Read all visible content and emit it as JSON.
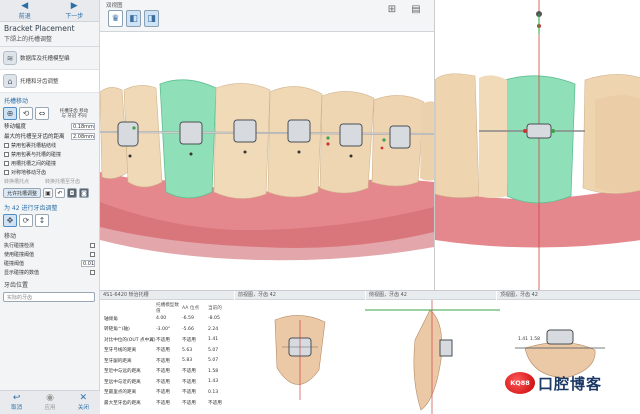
{
  "nav": {
    "prev": "前退",
    "next": "下一步"
  },
  "panel": {
    "title": "Bracket Placement",
    "subtitle": "下颌上的托槽调整",
    "steps": [
      {
        "label": "数据库及托槽模型编"
      },
      {
        "label": "托槽和牙齿调整"
      }
    ],
    "move_section": "托槽移动",
    "move_tool_text": "托槽牙齿 移动 与 牙冠 不同",
    "fields": [
      {
        "label": "移动幅度",
        "value": "0.18mm"
      },
      {
        "label": "最大的托槽至牙齿的距离",
        "value": "2.08mm"
      }
    ],
    "checks": [
      "禁用包裹托槽粘结线",
      "禁用包裹与托槽的碰撞",
      "用槽托槽之间的碰撞",
      "对称地移动牙齿"
    ],
    "grayed": "转换槽托点",
    "grayed2": "转换托槽至牙齿",
    "allow_button": "允许托槽调整",
    "adjust_section": "为 42 进行牙齿调整",
    "move_label": "移动",
    "options": [
      {
        "label": "执行碰撞检测",
        "value": ""
      },
      {
        "label": "使用碰撞阈值",
        "value": ""
      },
      {
        "label": "碰撞阈值",
        "value": "0.01"
      },
      {
        "label": "显示碰撞的数值",
        "value": ""
      }
    ],
    "tooth_section": "牙齿位置",
    "tooth_button": "实际的牙齿",
    "bottom": {
      "cancel": "取消",
      "apply": "应用",
      "close": "关闭"
    }
  },
  "view": {
    "title": "双视图",
    "toolbar_icons": [
      "tooth-front-icon",
      "panel-icon",
      "bracket-icon",
      "pin-icon",
      "arch-icon",
      "arch2-icon",
      "tooth-bracket-icon",
      "tooth-bracket2-icon",
      "tooth-bracket3-icon"
    ]
  },
  "bottom_panels": {
    "info": {
      "title": "4S1-6420 矫治托槽"
    },
    "front": {
      "title": "前视图，牙齿 42"
    },
    "side": {
      "title": "侧视图，牙齿 42"
    },
    "top": {
      "title": "顶视图，牙齿 42"
    },
    "table": {
      "headers": [
        "",
        "托槽模型数值",
        "AA 位点",
        "当前的"
      ],
      "rows": [
        [
          "轴倾角",
          "4.00",
          "-6.59",
          "-8.05"
        ],
        [
          "转矩角^(轴)",
          "-3.00°",
          "-5.66",
          "2.24"
        ],
        [
          "对比中位的(OUT 点中翼)",
          "不适用",
          "不适用",
          "1.41"
        ],
        [
          "至牙弓线的距离",
          "不适用",
          "5.63",
          "5.07"
        ],
        [
          "至牙龈的距离",
          "不适用",
          "5.83",
          "5.07"
        ],
        [
          "至近中与远的距离",
          "不适用",
          "不适用",
          "1.58"
        ],
        [
          "至远中与近的距离",
          "不适用",
          "不适用",
          "1.43"
        ],
        [
          "至最里点的距离",
          "不适用",
          "不适用",
          "0.13"
        ],
        [
          "最大至牙齿的距离",
          "不适用",
          "不适用",
          "不适用"
        ]
      ]
    },
    "top_labels": {
      "left": "1.41",
      "mid": "1.58"
    }
  },
  "watermark": {
    "logo": "KQ88",
    "text": "口腔博客"
  },
  "colors": {
    "accent": "#2b6fa8",
    "gum": "#e5888d",
    "tooth": "#f0d9b6",
    "selected_tooth": "#8fe0b8"
  }
}
